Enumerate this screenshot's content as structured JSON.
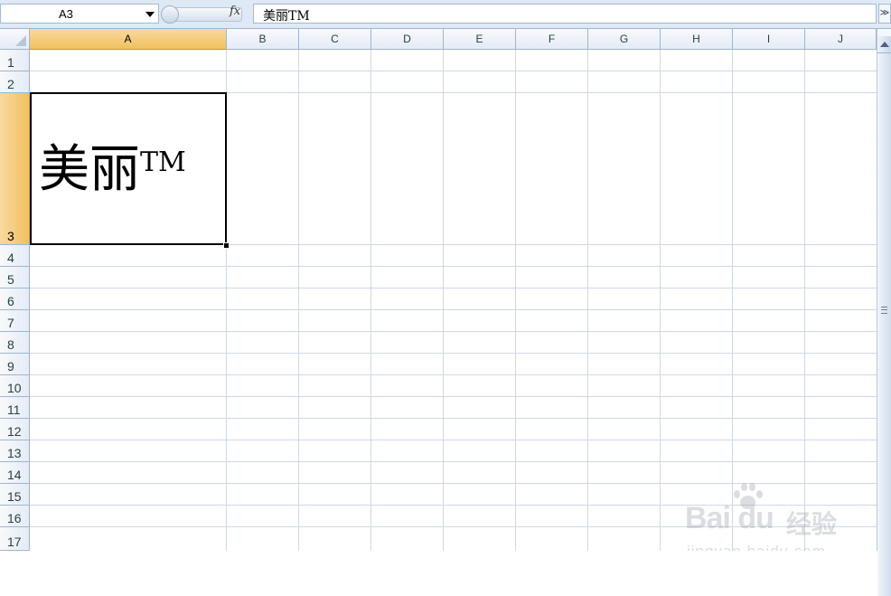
{
  "formula_bar": {
    "name_box": "A3",
    "fx_label": "fx",
    "content": "美丽TM",
    "expand_glyph": "≫"
  },
  "columns": [
    "A",
    "B",
    "C",
    "D",
    "E",
    "F",
    "G",
    "H",
    "I",
    "J"
  ],
  "rows": [
    "1",
    "2",
    "3",
    "4",
    "5",
    "6",
    "7",
    "8",
    "9",
    "10",
    "11",
    "12",
    "13",
    "14",
    "15",
    "16",
    "17"
  ],
  "active_cell": {
    "ref": "A3",
    "text": "美丽",
    "superscript": "TM"
  },
  "watermark": {
    "logo": "Bai du",
    "cn": "经验",
    "url": "jingyan.baidu.com"
  },
  "colors": {
    "header_bg": "#e4ecf7",
    "active_header": "#f1c15f",
    "gridline": "#d0d7e5"
  }
}
